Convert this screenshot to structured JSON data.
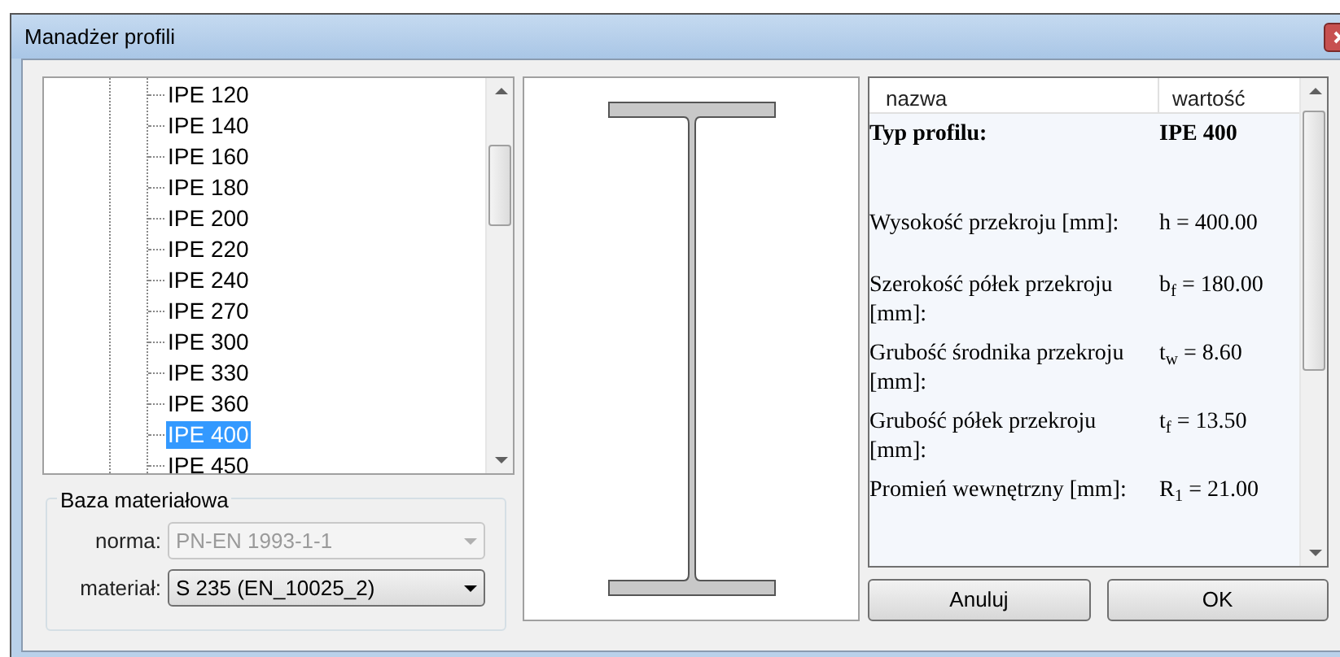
{
  "window": {
    "title": "Manadżer profili"
  },
  "tree": {
    "items": [
      {
        "label": "IPE 120",
        "selected": false
      },
      {
        "label": "IPE 140",
        "selected": false
      },
      {
        "label": "IPE 160",
        "selected": false
      },
      {
        "label": "IPE 180",
        "selected": false
      },
      {
        "label": "IPE 200",
        "selected": false
      },
      {
        "label": "IPE 220",
        "selected": false
      },
      {
        "label": "IPE 240",
        "selected": false
      },
      {
        "label": "IPE 270",
        "selected": false
      },
      {
        "label": "IPE 300",
        "selected": false
      },
      {
        "label": "IPE 330",
        "selected": false
      },
      {
        "label": "IPE 360",
        "selected": false
      },
      {
        "label": "IPE 400",
        "selected": true
      },
      {
        "label": "IPE 450",
        "selected": false
      }
    ]
  },
  "material_group": {
    "title": "Baza materiałowa",
    "fields": [
      {
        "label": "norma:",
        "value": "PN-EN 1993-1-1",
        "disabled": true
      },
      {
        "label": "materiał:",
        "value": "S 235 (EN_10025_2)",
        "disabled": false
      }
    ]
  },
  "properties": {
    "columns": [
      "nazwa",
      "wartość"
    ],
    "rows": [
      {
        "name": "Typ profilu:",
        "value": "IPE 400",
        "bold": true
      },
      {
        "name": "Wysokość przekroju [mm]:",
        "value": "h = 400.00",
        "bold": false
      },
      {
        "name": "Szerokość półek przekroju [mm]:",
        "value": "b$_{f}$ = 180.00",
        "bold": false
      },
      {
        "name": "Grubość środnika przekroju [mm]:",
        "value": "t$_{w}$ = 8.60",
        "bold": false
      },
      {
        "name": "Grubość półek przekroju [mm]:",
        "value": "t$_{f}$ = 13.50",
        "bold": false
      },
      {
        "name": "Promień wewnętrzny [mm]:",
        "value": "R$_{1}$ = 21.00",
        "bold": false
      }
    ]
  },
  "buttons": [
    "Anuluj",
    "OK"
  ]
}
